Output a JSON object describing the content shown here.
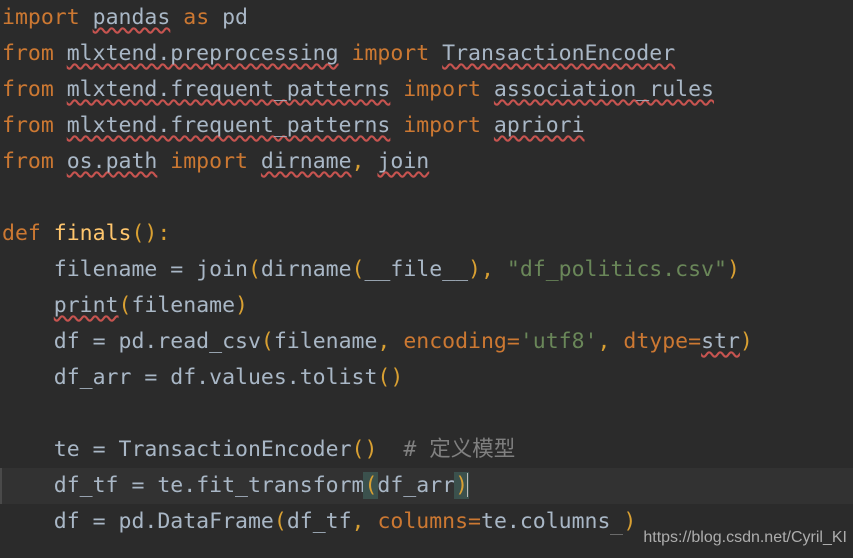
{
  "editor": {
    "language": "Python",
    "theme": "Darcula",
    "background_color": "#2b2b2b",
    "current_line_background": "#323232",
    "default_text_color": "#a9b7c6",
    "keyword_color": "#cc7832",
    "function_color": "#ffc66d",
    "string_color": "#6a8759",
    "comment_color": "#808080",
    "bracket_match_color": "#3b514d",
    "error_squiggle_color": "#c75450",
    "caret_color": "#bbbbbb"
  },
  "code": {
    "line_01": {
      "kw_import": "import",
      "mod_pandas": "pandas",
      "kw_as": "as",
      "alias_pd": "pd"
    },
    "line_02": {
      "kw_from": "from",
      "module": "mlxtend.preprocessing",
      "kw_import": "import",
      "name": "TransactionEncoder"
    },
    "line_03": {
      "kw_from": "from",
      "module": "mlxtend.frequent_patterns",
      "kw_import": "import",
      "name": "association_rules"
    },
    "line_04": {
      "kw_from": "from",
      "module": "mlxtend.frequent_patterns",
      "kw_import": "import",
      "name": "apriori"
    },
    "line_05": {
      "kw_from": "from",
      "module": "os.path",
      "kw_import": "import",
      "name_1": "dirname",
      "comma": ",",
      "name_2": "join"
    },
    "line_06": {
      "blank": " "
    },
    "line_07": {
      "kw_def": "def",
      "fn_name": "finals",
      "open_paren": "(",
      "close_paren": ")",
      "colon": ":"
    },
    "line_08": {
      "indent": "    ",
      "var": "filename",
      "assign": " = ",
      "call_join": "join",
      "p1": "(",
      "call_dirname": "dirname",
      "p2": "(",
      "dunder": "__file__",
      "p3": ")",
      "comma": ", ",
      "string": "\"df_politics.csv\"",
      "p4": ")"
    },
    "line_09": {
      "indent": "    ",
      "call_print": "print",
      "p1": "(",
      "arg": "filename",
      "p2": ")"
    },
    "line_10": {
      "indent": "    ",
      "var": "df",
      "assign": " = ",
      "call": "pd.read_csv",
      "p1": "(",
      "arg1": "filename",
      "comma1": ", ",
      "kwarg1": "encoding",
      "eq1": "=",
      "val1": "'utf8'",
      "comma2": ", ",
      "kwarg2": "dtype",
      "eq2": "=",
      "val2": "str",
      "p2": ")"
    },
    "line_11": {
      "indent": "    ",
      "var": "df_arr",
      "assign": " = ",
      "call": "df.values.tolist",
      "p1": "(",
      "p2": ")"
    },
    "line_12": {
      "blank": " "
    },
    "line_13": {
      "indent": "    ",
      "var": "te",
      "assign": " = ",
      "call": "TransactionEncoder",
      "p1": "(",
      "p2": ")",
      "gap": "  ",
      "comment": "# 定义模型"
    },
    "line_14": {
      "indent": "    ",
      "var": "df_tf",
      "assign": " = ",
      "call": "te.fit_transform",
      "p1": "(",
      "arg": "df_arr",
      "p2": ")"
    },
    "line_15": {
      "indent": "    ",
      "var": "df",
      "assign": " = ",
      "call": "pd.DataFrame",
      "p1": "(",
      "arg1": "df_tf",
      "comma1": ", ",
      "kwarg1": "columns",
      "eq1": "=",
      "val1": "te.columns",
      "trailing": " ",
      "p2": ")"
    }
  },
  "watermark": {
    "text": "https://blog.csdn.net/Cyril_KI"
  }
}
